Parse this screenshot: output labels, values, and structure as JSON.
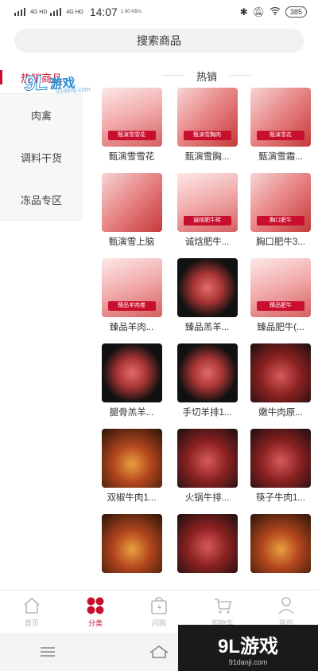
{
  "status_bar": {
    "network_1": "4G HD",
    "network_2": "4G HD",
    "time": "14:07",
    "speed": "1.90 KB/s",
    "battery": "385"
  },
  "search": {
    "placeholder": "搜索商品"
  },
  "sidebar": {
    "items": [
      {
        "label": "热销商品",
        "active": true
      },
      {
        "label": "肉禽",
        "active": false
      },
      {
        "label": "调料干货",
        "active": false
      },
      {
        "label": "冻品专区",
        "active": false
      }
    ]
  },
  "watermark": {
    "logo": "9L",
    "text": "游戏",
    "url": "91danji.com"
  },
  "section_title": "热销",
  "products": [
    {
      "name": "甄演雪雪花",
      "tag": "甄演雪雪花",
      "style": "t-pink"
    },
    {
      "name": "甄演雪胸...",
      "tag": "甄演雪胸肉",
      "style": "t-red"
    },
    {
      "name": "甄演雪霜...",
      "tag": "甄演雪花",
      "style": "t-red"
    },
    {
      "name": "甄演雪上脑",
      "tag": "",
      "style": "t-red"
    },
    {
      "name": "诚焓肥牛...",
      "tag": "诚焓肥牛砖",
      "style": "t-pink"
    },
    {
      "name": "胸口肥牛3...",
      "tag": "胸口肥牛",
      "style": "t-red"
    },
    {
      "name": "臻品羊肉...",
      "tag": "臻品羊肉卷",
      "style": "t-pink"
    },
    {
      "name": "臻品羔羊...",
      "tag": "",
      "style": "t-black"
    },
    {
      "name": "臻品肥牛(...",
      "tag": "臻品肥牛",
      "style": "t-pink"
    },
    {
      "name": "腿骨羔羊...",
      "tag": "",
      "style": "t-black"
    },
    {
      "name": "手切羊排1...",
      "tag": "",
      "style": "t-black"
    },
    {
      "name": "嫩牛肉原...",
      "tag": "",
      "style": "t-dark"
    },
    {
      "name": "双椒牛肉1...",
      "tag": "",
      "style": "t-food"
    },
    {
      "name": "火锅牛排...",
      "tag": "",
      "style": "t-dark"
    },
    {
      "name": "筷子牛肉1...",
      "tag": "",
      "style": "t-dark"
    },
    {
      "name": "",
      "tag": "",
      "style": "t-food"
    },
    {
      "name": "",
      "tag": "",
      "style": "t-dark"
    },
    {
      "name": "",
      "tag": "",
      "style": "t-food"
    }
  ],
  "tabbar": {
    "items": [
      {
        "label": "首页",
        "icon": "home-icon",
        "active": false
      },
      {
        "label": "分类",
        "icon": "category-icon",
        "active": true
      },
      {
        "label": "闪购",
        "icon": "flash-bag-icon",
        "active": false
      },
      {
        "label": "购物车",
        "icon": "cart-icon",
        "active": false
      },
      {
        "label": "我的",
        "icon": "user-icon",
        "active": false
      }
    ]
  },
  "corner_watermark": {
    "big": "9L游戏",
    "small": "91danji.com"
  },
  "colors": {
    "accent": "#c8102e",
    "inactive": "#b8b8b8"
  }
}
